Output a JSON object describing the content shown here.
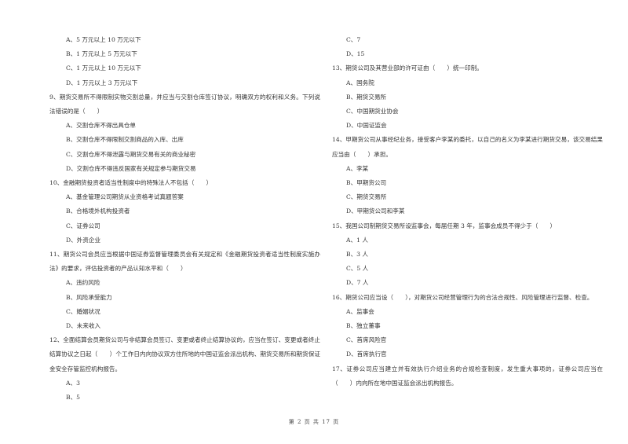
{
  "left_column": {
    "leading_options": [
      "A、5 万元以上 10 万元以下",
      "B、1 万元以上 5 万元以下",
      "C、1 万元以上 10 万元以下",
      "D、1 万元以上 3 万元以下"
    ],
    "questions": [
      {
        "number": "9",
        "text": "9、期货交易所不得限制实物交割总量，并应当与交割仓库签订协议，明确双方的权利和义务。下列说法错误的是（　　）",
        "options": [
          "A、交割仓库不得出具仓单",
          "B、交割仓库不得限制交割商品的入库、出库",
          "C、交割仓库不得泄露与期货交易有关的商业秘密",
          "D、交割仓库不得违反国家有关规定参与期货交易"
        ]
      },
      {
        "number": "10",
        "text": "10、金融期货投资者适当性制度中的特殊法人不包括（　　）",
        "options": [
          "A、基金管理公司期货从业资格考试真题答案",
          "B、合格境外机构投资者",
          "C、证券公司",
          "D、外资企业"
        ]
      },
      {
        "number": "11",
        "text": "11、期货公司会员应当根据中国证券监督管理委员会有关规定和《金融期货投资者适当性制度实施办法》的要求，评估投资者的产品认知水平和（　　）",
        "options": [
          "A、违约风险",
          "B、风险承受能力",
          "C、婚姻状况",
          "D、未来收入"
        ]
      },
      {
        "number": "12",
        "text": "12、全面结算会员期货公司与非结算会员签订、变更或者终止结算协议的，应当在签订、变更或者终止结算协议之日起（　　）个工作日内向协议双方住所地的中国证监会派出机构、期货交易所和期货保证金安全存管监控机构报告。",
        "options": [
          "A、3",
          "B、5"
        ]
      }
    ]
  },
  "right_column": {
    "leading_options": [
      "C、7",
      "D、15"
    ],
    "questions": [
      {
        "number": "13",
        "text": "13、期货公司及其营业部的许可证由（　　）统一印制。",
        "options": [
          "A、国务院",
          "B、期货交易所",
          "C、中国期货业协会",
          "D、中国证监会"
        ]
      },
      {
        "number": "14",
        "text": "14、甲期货公司从事经纪业务，接受客户李某的委托，以自己的名义为李某进行期货交易，该交易结果应当由（　　）承担。",
        "options": [
          "A、李某",
          "B、甲期货公司",
          "C、期货交易所",
          "D、甲期货公司和李某"
        ]
      },
      {
        "number": "15",
        "text": "15、我国公司制期货交易所设监事会，每届任期 3 年，监事会成员不得少于（　　）",
        "options": [
          "A、1 人",
          "B、3 人",
          "C、5 人",
          "D、7 人"
        ]
      },
      {
        "number": "16",
        "text": "16、期货公司应当设（　　），对期货公司经营管理行为的合法合规性、风险管理进行监督、检查。",
        "options": [
          "A、监事会",
          "B、独立董事",
          "C、首席风险官",
          "D、首席执行官"
        ]
      },
      {
        "number": "17",
        "text": "17、证券公司应当建立并有效执行介绍业务的合规检查制度，发生重大事项的，证券公司应当在（　　）内向所在地中国证监会派出机构报告。",
        "options": []
      }
    ]
  },
  "footer": {
    "page_label": "第 2 页 共 17 页"
  }
}
